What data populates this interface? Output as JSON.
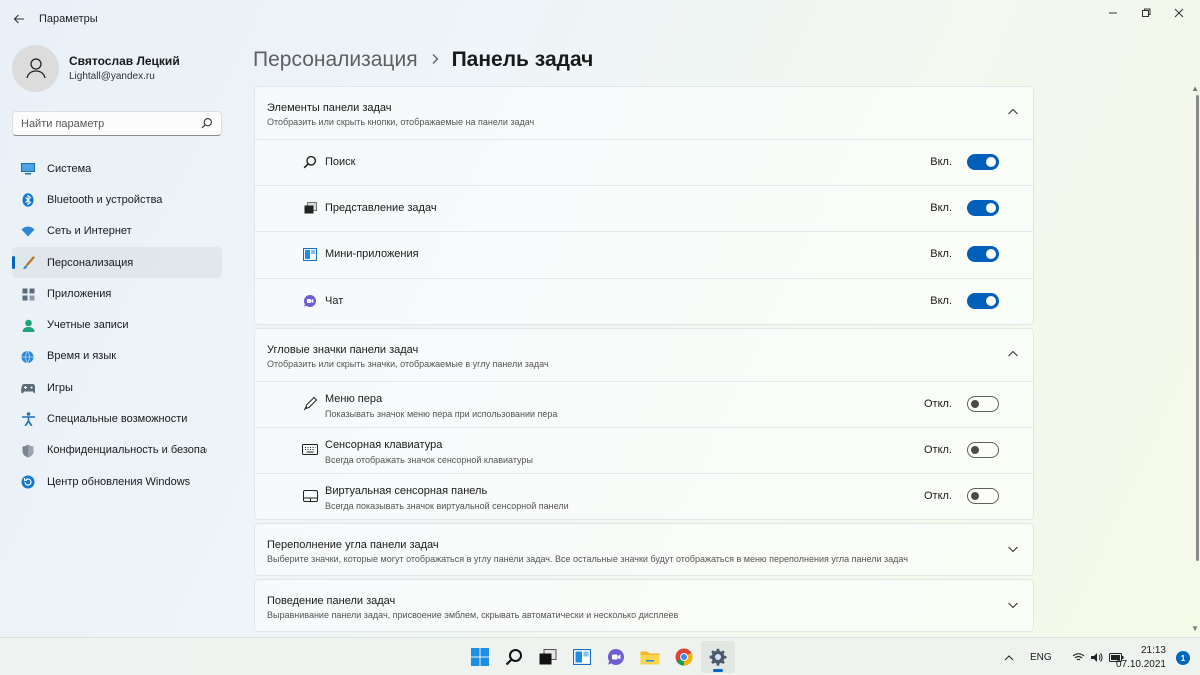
{
  "window": {
    "title": "Параметры"
  },
  "profile": {
    "name": "Святослав Лецкий",
    "email": "Lightall@yandex.ru"
  },
  "search": {
    "placeholder": "Найти параметр"
  },
  "sidebar": {
    "items": [
      {
        "label": "Система",
        "icon": "monitor-icon",
        "selected": false
      },
      {
        "label": "Bluetooth и устройства",
        "icon": "bluetooth-icon",
        "selected": false
      },
      {
        "label": "Сеть и Интернет",
        "icon": "wifi-icon",
        "selected": false
      },
      {
        "label": "Персонализация",
        "icon": "brush-icon",
        "selected": true
      },
      {
        "label": "Приложения",
        "icon": "apps-icon",
        "selected": false
      },
      {
        "label": "Учетные записи",
        "icon": "person-icon",
        "selected": false
      },
      {
        "label": "Время и язык",
        "icon": "globe-clock-icon",
        "selected": false
      },
      {
        "label": "Игры",
        "icon": "gamepad-icon",
        "selected": false
      },
      {
        "label": "Специальные возможности",
        "icon": "accessibility-icon",
        "selected": false
      },
      {
        "label": "Конфиденциальность и безопасность",
        "icon": "shield-icon",
        "selected": false
      },
      {
        "label": "Центр обновления Windows",
        "icon": "update-icon",
        "selected": false
      }
    ]
  },
  "breadcrumb": {
    "parent": "Персонализация",
    "current": "Панель задач"
  },
  "groups": {
    "taskbar_items": {
      "title": "Элементы панели задач",
      "subtitle": "Отобразить или скрыть кнопки, отображаемые на панели задач",
      "rows": [
        {
          "label": "Поиск",
          "state": "Вкл.",
          "on": true,
          "icon": "search-icon"
        },
        {
          "label": "Представление задач",
          "state": "Вкл.",
          "on": true,
          "icon": "task-view-icon"
        },
        {
          "label": "Мини-приложения",
          "state": "Вкл.",
          "on": true,
          "icon": "widgets-icon"
        },
        {
          "label": "Чат",
          "state": "Вкл.",
          "on": true,
          "icon": "chat-icon"
        }
      ]
    },
    "corner_icons": {
      "title": "Угловые значки панели задач",
      "subtitle": "Отобразить или скрыть значки, отображаемые в углу панели задач",
      "rows": [
        {
          "label": "Меню пера",
          "sub": "Показывать значок меню пера при использовании пера",
          "state": "Откл.",
          "on": false,
          "icon": "pen-icon"
        },
        {
          "label": "Сенсорная клавиатура",
          "sub": "Всегда отображать значок сенсорной клавиатуры",
          "state": "Откл.",
          "on": false,
          "icon": "keyboard-icon"
        },
        {
          "label": "Виртуальная сенсорная панель",
          "sub": "Всегда показывать значок виртуальной сенсорной панели",
          "state": "Откл.",
          "on": false,
          "icon": "touchpad-icon"
        }
      ]
    },
    "overflow": {
      "title": "Переполнение угла панели задач",
      "subtitle": "Выберите значки, которые могут отображаться в углу панели задач. Все остальные значки будут отображаться в меню переполнения угла панели задач"
    },
    "behavior": {
      "title": "Поведение панели задач",
      "subtitle": "Выравнивание панели задач, присвоение эмблем, скрывать автоматически и несколько дисплеев"
    }
  },
  "taskbar": {
    "language": "ENG",
    "time": "21:13",
    "date": "07.10.2021",
    "notifications": "1"
  },
  "colors": {
    "accent": "#005fb8"
  }
}
